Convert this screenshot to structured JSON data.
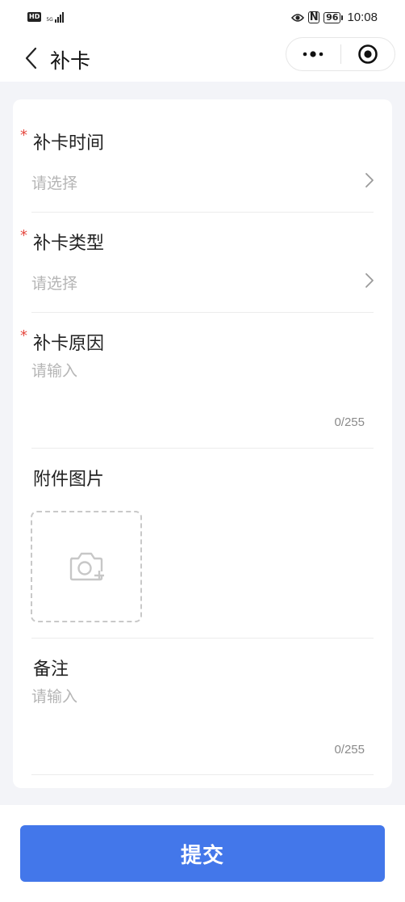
{
  "status_bar": {
    "hd": "HD",
    "signal_label": "5G",
    "nfc": "N",
    "battery": "96",
    "time": "10:08"
  },
  "nav": {
    "title": "补卡"
  },
  "form": {
    "time_field": {
      "required_mark": "*",
      "label": "补卡时间",
      "placeholder": "请选择"
    },
    "type_field": {
      "required_mark": "*",
      "label": "补卡类型",
      "placeholder": "请选择"
    },
    "reason_field": {
      "required_mark": "*",
      "label": "补卡原因",
      "placeholder": "请输入",
      "counter": "0/255"
    },
    "attachment_field": {
      "label": "附件图片"
    },
    "remark_field": {
      "label": "备注",
      "placeholder": "请输入",
      "counter": "0/255"
    }
  },
  "submit_label": "提交",
  "colors": {
    "accent": "#4377ea",
    "required": "#e5483f",
    "page_bg": "#f3f4f8"
  },
  "icons": [
    "back-arrow-icon",
    "more-dots-icon",
    "close-miniprogram-icon",
    "chevron-right-icon",
    "camera-add-icon",
    "eye-icon",
    "nfc-icon",
    "battery-icon",
    "signal-icon"
  ]
}
